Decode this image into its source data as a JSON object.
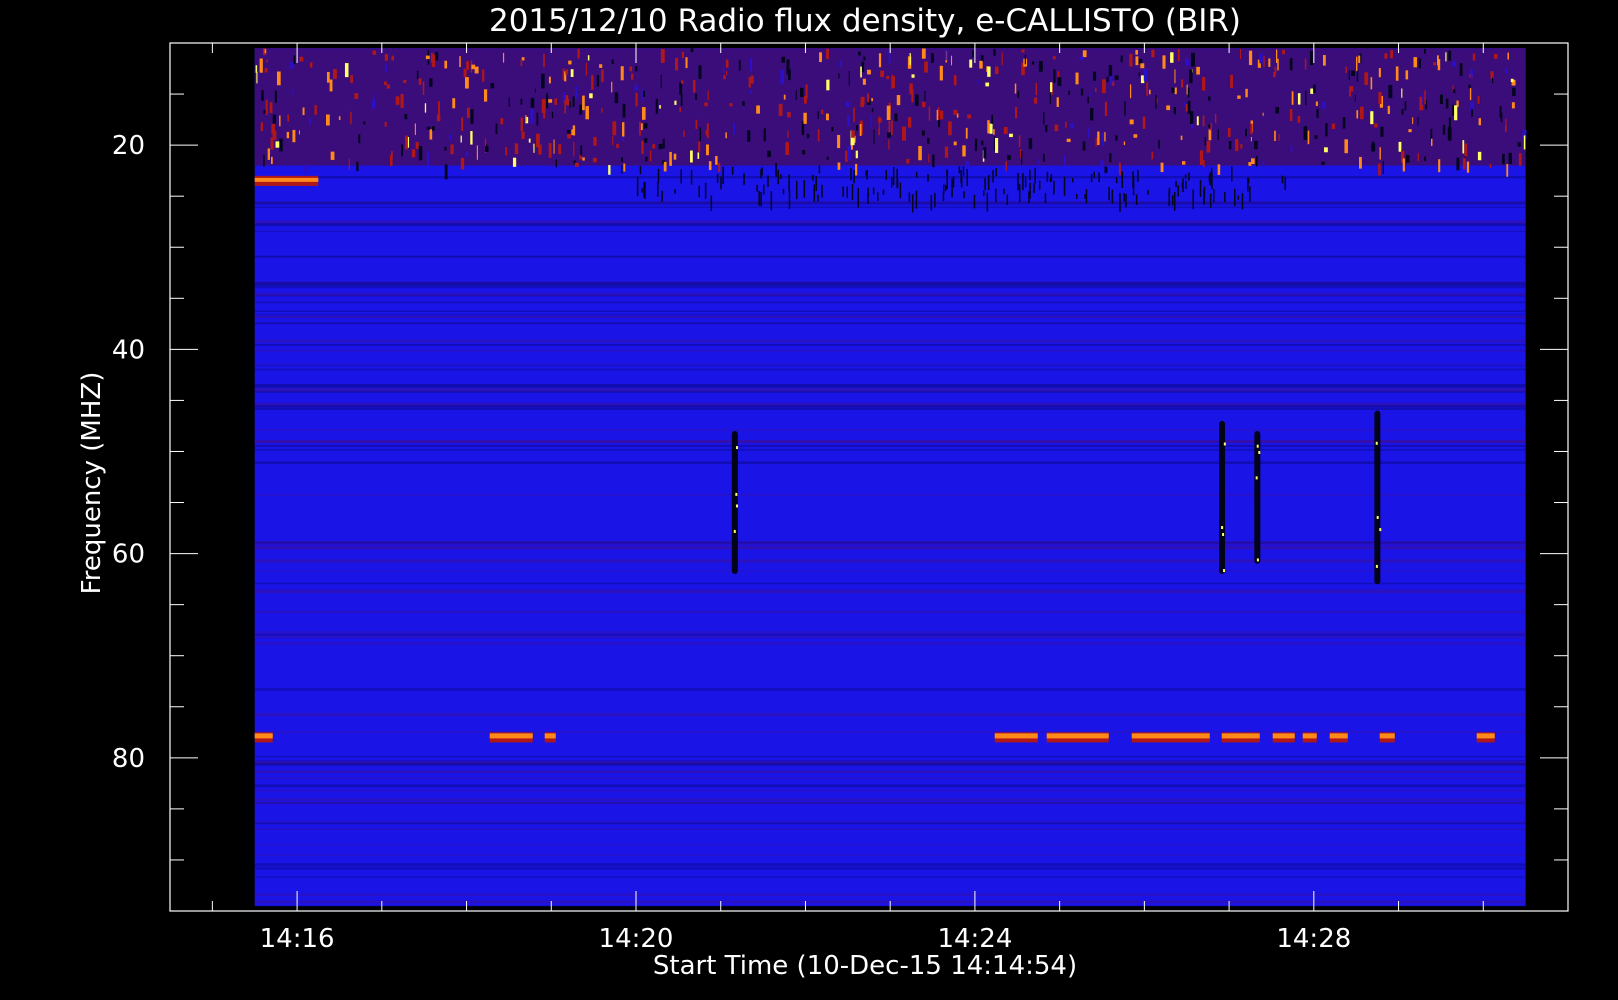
{
  "chart_data": {
    "type": "heatmap",
    "title": "2015/12/10  Radio flux density, e-CALLISTO (BIR)",
    "xlabel": "Start Time (10-Dec-15 14:14:54)",
    "ylabel": "Frequency (MHZ)",
    "x_range": [
      "14:14:30",
      "14:31:00"
    ],
    "y_range": [
      95,
      10
    ],
    "data_extent": {
      "x": [
        "14:15:30",
        "14:30:30"
      ],
      "y": [
        10.5,
        94.5
      ]
    },
    "x_ticks": [
      "14:16",
      "14:20",
      "14:24",
      "14:28"
    ],
    "y_ticks": [
      20,
      40,
      60,
      80
    ],
    "x_minor_interval_minutes": 1,
    "y_minor_interval": 5,
    "background_intensity": "low",
    "features": [
      {
        "kind": "interference-band",
        "freq_range": [
          10.5,
          22
        ],
        "intensity": "high"
      },
      {
        "kind": "interference-line",
        "freq": 23.5,
        "time_range": [
          "14:15:30",
          "14:16:15"
        ],
        "intensity": "high"
      },
      {
        "kind": "interference-line",
        "freq": 78,
        "time_range": [
          "14:15:30",
          "14:30:30"
        ],
        "intensity": "high",
        "intermittent": true
      },
      {
        "kind": "burst",
        "time": "14:21:10",
        "freq_range": [
          48,
          62
        ]
      },
      {
        "kind": "burst",
        "time": "14:26:55",
        "freq_range": [
          47,
          62
        ]
      },
      {
        "kind": "burst",
        "time": "14:27:20",
        "freq_range": [
          48,
          61
        ]
      },
      {
        "kind": "burst",
        "time": "14:28:45",
        "freq_range": [
          46,
          63
        ]
      }
    ],
    "colors": {
      "background": "#000000",
      "low": "#1a14e6",
      "mid": "#b01818",
      "high": "#ff8a1a",
      "peak": "#ffff66"
    }
  }
}
